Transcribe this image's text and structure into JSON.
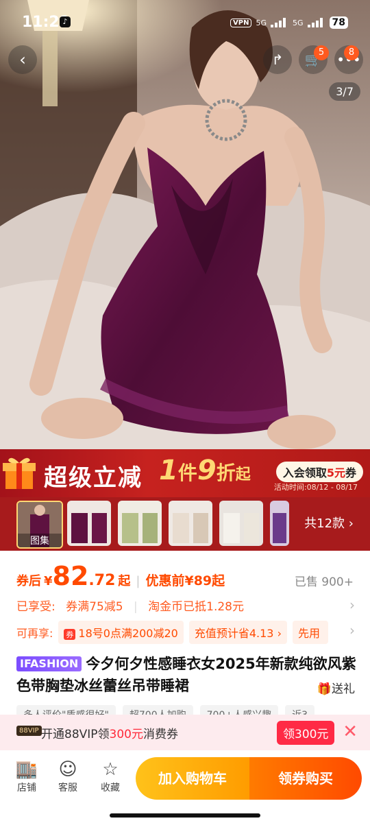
{
  "status_bar": {
    "time": "11:21",
    "vpn": "VPN",
    "net1": "5G",
    "net2": "5G",
    "battery": "78"
  },
  "header": {
    "cart_badge": "5",
    "more_badge": "8",
    "image_counter": "3/7"
  },
  "promo": {
    "title": "超级立减",
    "offer_num1": "1",
    "offer_word1": "件",
    "offer_num2": "9",
    "offer_word2": "折",
    "offer_suffix": "起",
    "pill_prefix": "入会领取",
    "pill_amount": "5元",
    "pill_suffix": "券",
    "time": "活动时间:08/12 - 08/17"
  },
  "gallery": {
    "first_label": "图集",
    "total": "共12款",
    "thumb_count": 6
  },
  "price": {
    "prefix": "券后",
    "currency": "¥",
    "integer": "82",
    "decimal": ".72",
    "suffix": "起",
    "original": "优惠前¥89起",
    "sold": "已售 900+"
  },
  "benefits": {
    "label": "已享受:",
    "item1": "券满75减5",
    "item2": "淘金币已抵1.28元"
  },
  "offers": {
    "label": "可再享:",
    "chip1_icon": "券",
    "chip1": "18号0点满200减20",
    "chip2": "充值预计省4.13",
    "chip3": "先用"
  },
  "product": {
    "brand": "IFASHION",
    "title": "今夕何夕性感睡衣女2025年新款纯欲风紫色带胸垫冰丝蕾丝吊带睡裙",
    "gift": "送礼"
  },
  "tags": [
    "多人评价\"质感很好\"",
    "超700人加购",
    "700+人感兴趣",
    "近3"
  ],
  "vip": {
    "logo": "88VIP",
    "text_prefix": "开通88VIP领",
    "amount": "300元",
    "text_suffix": "消费券",
    "button": "领300元"
  },
  "bottom_bar": {
    "shop": "店铺",
    "service": "客服",
    "favorite": "收藏",
    "add_cart": "加入购物车",
    "buy": "领券购买"
  },
  "colors": {
    "accent": "#ff4a00",
    "promo_red": "#b01a18",
    "dress_purple": "#5e1240",
    "vip_pink": "#fdebee"
  }
}
